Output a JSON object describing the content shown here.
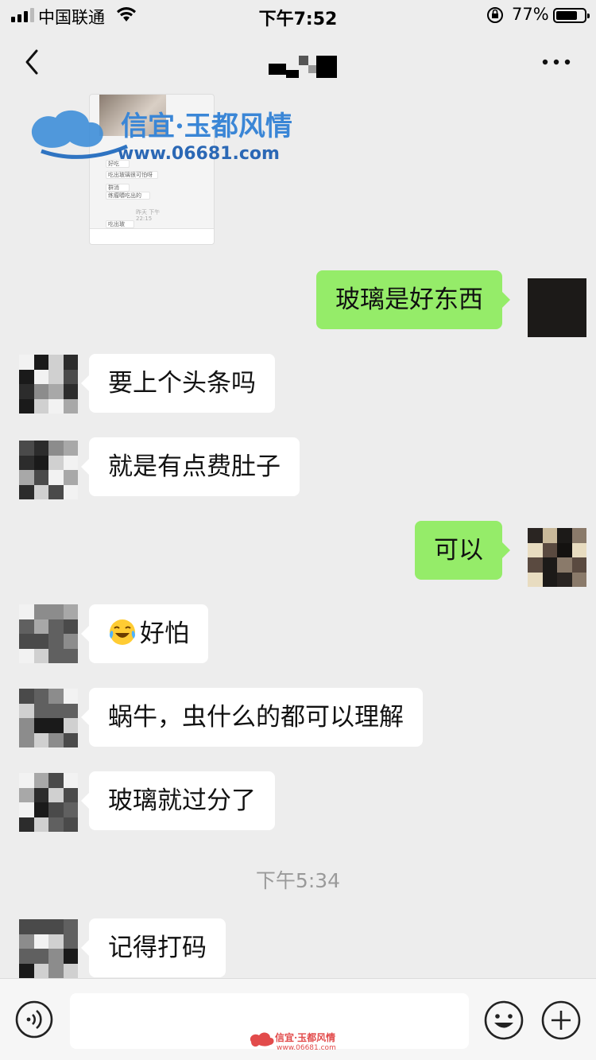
{
  "status_bar": {
    "carrier": "中国联通",
    "time": "下午7:52",
    "battery": "77%",
    "battery_level": 0.77
  },
  "watermark": {
    "brand": "信宜·玉都风情",
    "url": "www.06681.com"
  },
  "shared_image": {
    "lines": [
      "好吃",
      "吃出玻璃很可怕呀",
      "群消",
      "练瘤嚼吃出的",
      "昨天 下午 22:15",
      "吃出玻"
    ]
  },
  "messages": [
    {
      "side": "right",
      "text": "玻璃是好东西"
    },
    {
      "side": "left",
      "text": "要上个头条吗"
    },
    {
      "side": "left",
      "text": "就是有点费肚子"
    },
    {
      "side": "right",
      "text": "可以"
    },
    {
      "side": "left",
      "text": "好怕",
      "emoji": "tears-of-joy-emoji"
    },
    {
      "side": "left",
      "text": "蜗牛，虫什么的都可以理解"
    },
    {
      "side": "left",
      "text": "玻璃就过分了"
    },
    {
      "side": "left",
      "text": "记得打码"
    }
  ],
  "time_separator": "下午5:34",
  "bottom_watermark": {
    "brand": "信宜·玉都风情",
    "url": "www.06681.com"
  },
  "input": {
    "value": ""
  },
  "colors": {
    "background": "#ededed",
    "self_bubble": "#95ec69",
    "other_bubble": "#ffffff"
  }
}
